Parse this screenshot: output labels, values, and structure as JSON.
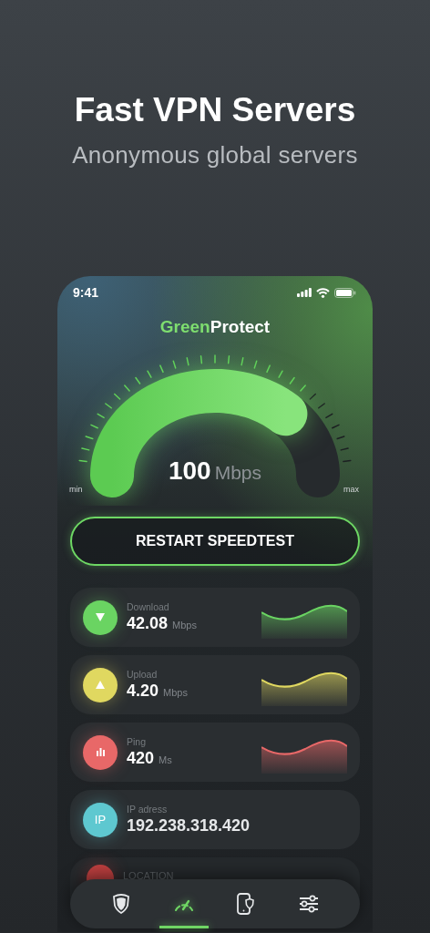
{
  "headline": {
    "title": "Fast VPN Servers",
    "subtitle": "Anonymous global servers"
  },
  "status_bar": {
    "time": "9:41"
  },
  "logo": {
    "accent": "Green",
    "rest": "Protect"
  },
  "gauge": {
    "level": 0.74,
    "value": "100",
    "unit": "Mbps",
    "min_label": "min",
    "max_label": "max"
  },
  "restart_button": "RESTART SPEEDTEST",
  "stats": [
    {
      "kind": "download",
      "label": "Download",
      "value": "42.08",
      "unit": "Mbps",
      "color": "#6ad462"
    },
    {
      "kind": "upload",
      "label": "Upload",
      "value": "4.20",
      "unit": "Mbps",
      "color": "#e0d860"
    },
    {
      "kind": "ping",
      "label": "Ping",
      "value": "420",
      "unit": "Ms",
      "color": "#e86868"
    },
    {
      "kind": "ip",
      "badge": "IP",
      "label": "IP adress",
      "value": "192.238.318.420",
      "color": "#5ec8d0"
    },
    {
      "kind": "location",
      "label": "LOCATION",
      "color": "#c04040"
    }
  ],
  "nav": [
    {
      "kind": "shield",
      "selected": false
    },
    {
      "kind": "speed",
      "selected": true
    },
    {
      "kind": "device",
      "selected": false
    },
    {
      "kind": "settings",
      "selected": false
    }
  ]
}
